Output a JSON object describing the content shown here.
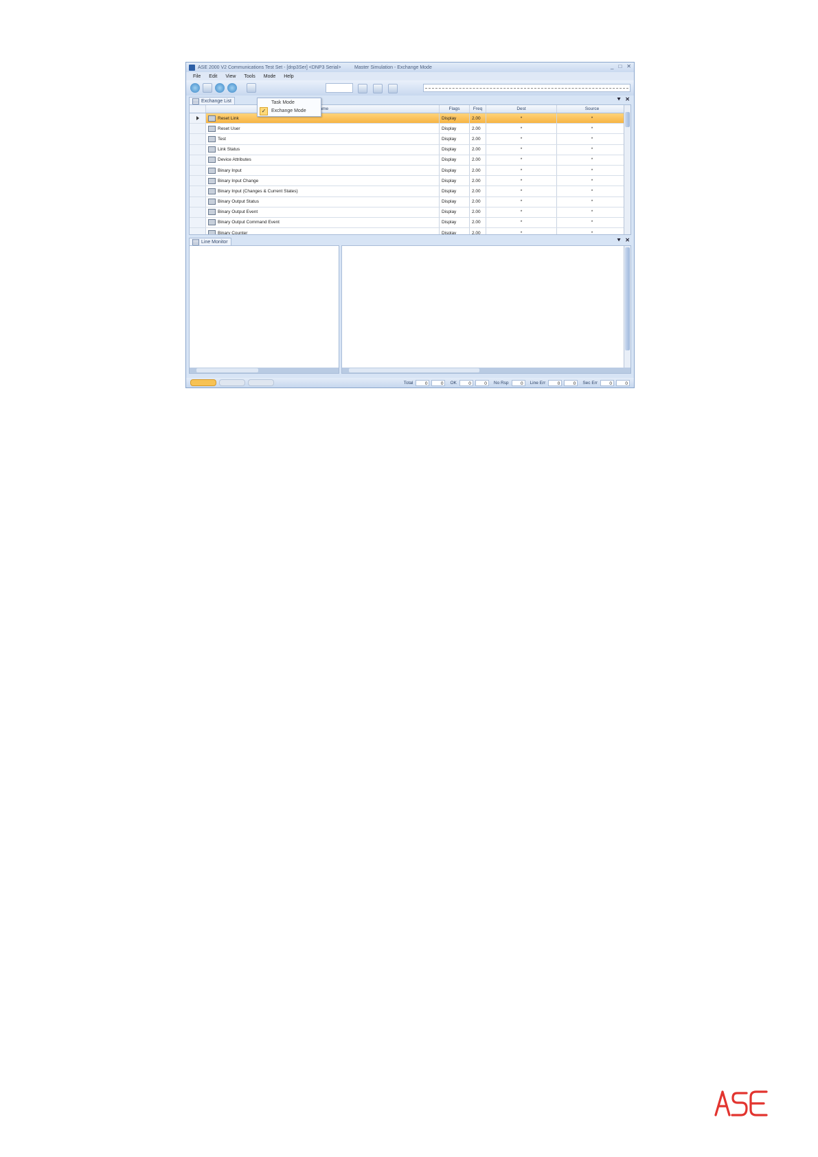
{
  "window": {
    "title": "ASE 2000 V2 Communications Test Set - [dnp3Ser] <DNP3 Serial>",
    "subtitle": "Master Simulation - Exchange Mode",
    "minimize": "_",
    "maximize": "□",
    "close": "✕"
  },
  "menu": [
    "File",
    "Edit",
    "View",
    "Tools",
    "Mode",
    "Help"
  ],
  "mode_dropdown": {
    "items": [
      {
        "label": "Task Mode",
        "checked": false
      },
      {
        "label": "Exchange Mode",
        "checked": true
      }
    ],
    "check_glyph": "✓"
  },
  "exchange_panel": {
    "tab_label": "Exchange List",
    "pin": "⯆",
    "close": "✕",
    "columns": [
      "Name",
      "Flags",
      "Freq",
      "Dest",
      "Source"
    ],
    "rows": [
      {
        "name": "Reset Link",
        "flags": "Display",
        "freq": "2.00",
        "dest": "*",
        "source": "*"
      },
      {
        "name": "Reset User",
        "flags": "Display",
        "freq": "2.00",
        "dest": "*",
        "source": "*"
      },
      {
        "name": "Test",
        "flags": "Display",
        "freq": "2.00",
        "dest": "*",
        "source": "*"
      },
      {
        "name": "Link Status",
        "flags": "Display",
        "freq": "2.00",
        "dest": "*",
        "source": "*"
      },
      {
        "name": "Device Attributes",
        "flags": "Display",
        "freq": "2.00",
        "dest": "*",
        "source": "*"
      },
      {
        "name": "Binary Input",
        "flags": "Display",
        "freq": "2.00",
        "dest": "*",
        "source": "*"
      },
      {
        "name": "Binary Input Change",
        "flags": "Display",
        "freq": "2.00",
        "dest": "*",
        "source": "*"
      },
      {
        "name": "Binary Input (Changes & Current States)",
        "flags": "Display",
        "freq": "2.00",
        "dest": "*",
        "source": "*"
      },
      {
        "name": "Binary Output Status",
        "flags": "Display",
        "freq": "2.00",
        "dest": "*",
        "source": "*"
      },
      {
        "name": "Binary Output Event",
        "flags": "Display",
        "freq": "2.00",
        "dest": "*",
        "source": "*"
      },
      {
        "name": "Binary Output Command Event",
        "flags": "Display",
        "freq": "2.00",
        "dest": "*",
        "source": "*"
      },
      {
        "name": "Binary Counter",
        "flags": "Display",
        "freq": "2.00",
        "dest": "*",
        "source": "*"
      }
    ]
  },
  "line_monitor": {
    "tab_label": "Line Monitor",
    "pin": "⯆",
    "close": "✕"
  },
  "status": {
    "total_label": "Total",
    "total_a": "0",
    "total_b": "0",
    "ok_label": "OK",
    "ok_a": "0",
    "ok_b": "0",
    "norsp_label": "No Rsp",
    "norsp_a": "0",
    "lineerr_label": "Line Err",
    "lineerr_a": "0",
    "lineerr_b": "0",
    "secerr_label": "Sec Err",
    "secerr_a": "0",
    "secerr_b": "0"
  },
  "logo": {
    "text": "ASE",
    "color": "#e2342f"
  }
}
